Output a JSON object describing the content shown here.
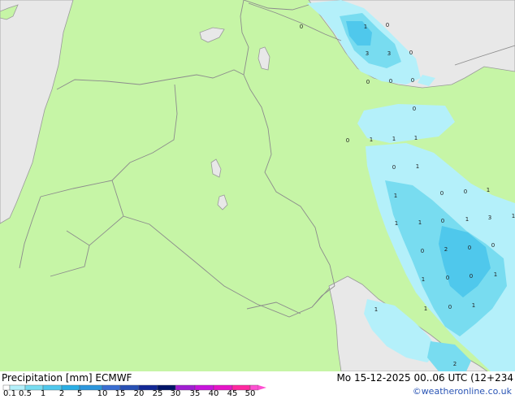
{
  "legend": {
    "title": "Precipitation [mm]  ECMWF",
    "date": "Mo 15-12-2025 00..06 UTC (12+234",
    "credit": "©weatheronline.co.uk",
    "ticks": [
      "0.1",
      "0.5",
      "1",
      "2",
      "5",
      "10",
      "15",
      "20",
      "25",
      "30",
      "35",
      "40",
      "45",
      "50"
    ],
    "colors": [
      "#ffffff",
      "#b4f0fa",
      "#78dcf0",
      "#4fc8ec",
      "#2aaee4",
      "#2c96dc",
      "#3a6ed2",
      "#2850b4",
      "#122896",
      "#001468",
      "#a01ed2",
      "#c814dc",
      "#e614c8",
      "#ff28a0",
      "#ff50d2"
    ]
  },
  "colors": {
    "land": "#c6f5a6",
    "sea": "#e8e8e8",
    "border": "#8c8c8c",
    "coast": "#9a9a9a",
    "light_precip": "#b4f0fa",
    "moderate_precip": "#78dcf0",
    "heavy_precip": "#4fc8ec"
  },
  "values": [
    "0",
    "1",
    "0",
    "3",
    "3",
    "0",
    "0",
    "0",
    "0",
    "0",
    "0",
    "1",
    "1",
    "1",
    "0",
    "1",
    "1",
    "0",
    "0",
    "1",
    "1",
    "1",
    "0",
    "1",
    "3",
    "1",
    "0",
    "2",
    "0",
    "0",
    "1",
    "0",
    "0",
    "1",
    "1",
    "1",
    "0",
    "1",
    "2"
  ]
}
